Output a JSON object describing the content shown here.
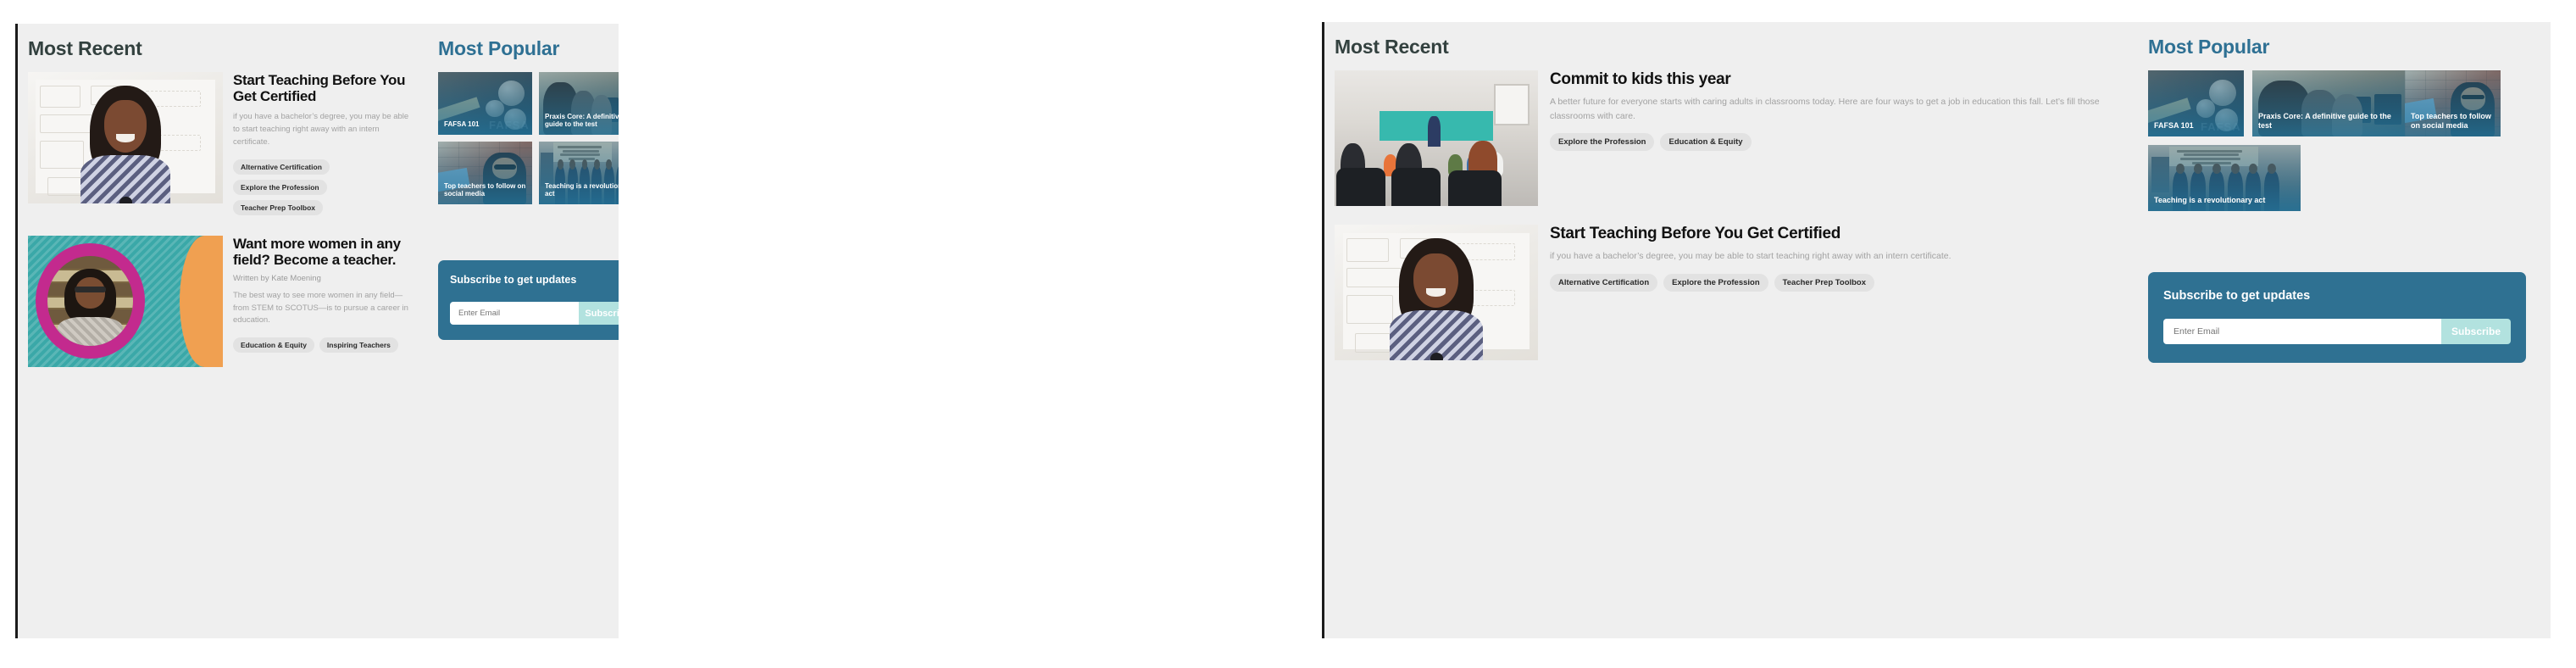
{
  "panels": [
    {
      "id": "left",
      "recent_heading": "Most Recent",
      "popular_heading": "Most Popular",
      "articles": [
        {
          "title": "Start Teaching Before You Get Certified",
          "byline": "",
          "excerpt": "if you have a bachelor’s degree, you may be able to start teaching right away with an intern certificate.",
          "tags": [
            "Alternative Certification",
            "Explore the Profession",
            "Teacher Prep Toolbox"
          ],
          "image": "teacher-at-whiteboard"
        },
        {
          "title": "Want more women in any field? Become a teacher.",
          "byline": "Written by Kate Moening",
          "excerpt": "The best way to see more women in any field—from STEM to SCOTUS—is to pursue a career in education.",
          "tags": [
            "Education & Equity",
            "Inspiring Teachers"
          ],
          "image": "judge-portrait-graphic"
        }
      ],
      "popular_cards": [
        {
          "caption": "FAFSA 101",
          "image": "fafsa-money"
        },
        {
          "caption": "Praxis Core: A definitive guide to the test",
          "image": "computer-lab"
        },
        {
          "caption": "Top teachers to follow on social media",
          "image": "teacher-on-brick-wall"
        },
        {
          "caption": "Teaching is a revolutionary act",
          "image": "school-board-group"
        }
      ],
      "subscribe": {
        "title": "Subscribe to get updates",
        "email_placeholder": "Enter Email",
        "button_label": "Subscribe"
      }
    },
    {
      "id": "right",
      "recent_heading": "Most Recent",
      "popular_heading": "Most Popular",
      "articles": [
        {
          "title": "Commit to kids this year",
          "byline": "",
          "excerpt": "A better future for everyone starts with caring adults in classrooms today. Here are four ways to get a job in education this fall. Let’s fill those classrooms with care.",
          "tags": [
            "Explore the Profession",
            "Education & Equity"
          ],
          "image": "classroom-audience"
        },
        {
          "title": "Start Teaching Before You Get Certified",
          "byline": "",
          "excerpt": "if you have a bachelor’s degree, you may be able to start teaching right away with an intern certificate.",
          "tags": [
            "Alternative Certification",
            "Explore the Profession",
            "Teacher Prep Toolbox"
          ],
          "image": "teacher-at-whiteboard"
        }
      ],
      "popular_cards": [
        {
          "caption": "FAFSA 101",
          "image": "fafsa-money"
        },
        {
          "caption": "Praxis Core: A definitive guide to the test",
          "image": "computer-lab"
        },
        {
          "caption": "Top teachers to follow on social media",
          "image": "teacher-on-brick-wall"
        },
        {
          "caption": "Teaching is a revolutionary act",
          "image": "school-board-group"
        }
      ],
      "subscribe": {
        "title": "Subscribe to get updates",
        "email_placeholder": "Enter Email",
        "button_label": "Subscribe"
      }
    }
  ],
  "colors": {
    "panel_bg": "#efefef",
    "panel_border": "#1b1b1b",
    "heading_dark": "#33413f",
    "heading_blue": "#2e7093",
    "tag_bg": "#e2e2e2",
    "subscribe_bg": "#2f7192",
    "subscribe_button_bg": "#b2e2df",
    "card_tint": "#2f7192",
    "graphic_teal": "#3aa8a8",
    "graphic_magenta": "#c32a8e",
    "graphic_orange": "#f0a051"
  }
}
